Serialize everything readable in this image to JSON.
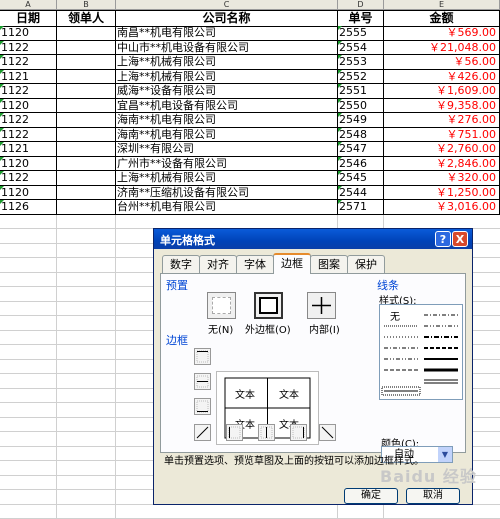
{
  "sheet": {
    "col_letters": [
      "A",
      "B",
      "C",
      "D",
      "E"
    ],
    "headers": [
      "日期",
      "领单人",
      "公司名称",
      "单号",
      "金额"
    ],
    "rows": [
      {
        "date": "1120",
        "person": "",
        "company": "南昌**机电有限公司",
        "no": "2555",
        "amount": "￥569.00"
      },
      {
        "date": "1122",
        "person": "",
        "company": "中山市**机电设备有限公司",
        "no": "2554",
        "amount": "￥21,048.00"
      },
      {
        "date": "1122",
        "person": "",
        "company": "上海**机械有限公司",
        "no": "2553",
        "amount": "￥56.00"
      },
      {
        "date": "1121",
        "person": "",
        "company": "上海**机械有限公司",
        "no": "2552",
        "amount": "￥426.00"
      },
      {
        "date": "1122",
        "person": "",
        "company": "威海**设备有限公司",
        "no": "2551",
        "amount": "￥1,609.00"
      },
      {
        "date": "1120",
        "person": "",
        "company": "宜昌**机电设备有限公司",
        "no": "2550",
        "amount": "￥9,358.00"
      },
      {
        "date": "1122",
        "person": "",
        "company": "海南**机电有限公司",
        "no": "2549",
        "amount": "￥276.00"
      },
      {
        "date": "1122",
        "person": "",
        "company": "海南**机电有限公司",
        "no": "2548",
        "amount": "￥751.00"
      },
      {
        "date": "1121",
        "person": "",
        "company": "深圳**有限公司",
        "no": "2547",
        "amount": "￥2,760.00"
      },
      {
        "date": "1120",
        "person": "",
        "company": "广州市**设备有限公司",
        "no": "2546",
        "amount": "￥2,846.00"
      },
      {
        "date": "1122",
        "person": "",
        "company": "上海**机械有限公司",
        "no": "2545",
        "amount": "￥320.00"
      },
      {
        "date": "1120",
        "person": "",
        "company": "济南**压缩机设备有限公司",
        "no": "2544",
        "amount": "￥1,250.00"
      },
      {
        "date": "1126",
        "person": "",
        "company": "台州**机电有限公司",
        "no": "2571",
        "amount": "￥3,016.00"
      }
    ],
    "amount_color": "#ff0000"
  },
  "dialog": {
    "title": "单元格格式",
    "help": "?",
    "close": "X",
    "tabs": [
      "数字",
      "对齐",
      "字体",
      "边框",
      "图案",
      "保护"
    ],
    "active_tab": "边框",
    "presets_label": "预置",
    "preset_none": "无(N)",
    "preset_outline": "外边框(O)",
    "preset_inside": "内部(I)",
    "border_label": "边框",
    "preview_text": [
      "文本",
      "文本",
      "文本",
      "文本"
    ],
    "line_label": "线条",
    "style_label": "样式(S):",
    "style_none": "无",
    "color_label": "颜色(C):",
    "color_value": "自动",
    "hint": "单击预置选项、预览草图及上面的按钮可以添加边框样式。",
    "ok": "确定",
    "cancel": "取消"
  },
  "watermark": "Baidu 经验"
}
